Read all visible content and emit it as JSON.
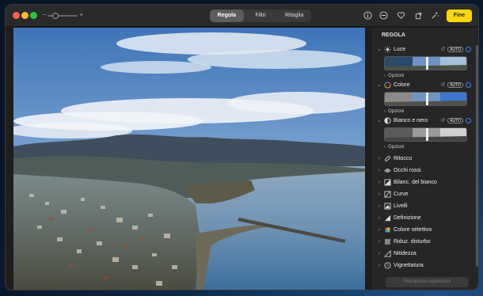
{
  "toolbar": {
    "tabs": [
      {
        "label": "Regola",
        "active": true
      },
      {
        "label": "Filtri",
        "active": false
      },
      {
        "label": "Ritaglia",
        "active": false
      }
    ],
    "done_label": "Fine",
    "icons": [
      "info-icon",
      "minus-circle-icon",
      "heart-icon",
      "rotate-icon",
      "magic-wand-icon"
    ]
  },
  "sidebar": {
    "title": "REGOLA",
    "expanded": [
      {
        "label": "Luce",
        "auto": "AUTO",
        "options": "Opzioni",
        "icon": "sun-icon"
      },
      {
        "label": "Colore",
        "auto": "AUTO",
        "options": "Opzioni",
        "icon": "color-circle-icon"
      },
      {
        "label": "Bianco e nero",
        "auto": "AUTO",
        "options": "Opzioni",
        "icon": "half-circle-icon"
      }
    ],
    "items": [
      {
        "label": "Ritocco",
        "icon": "bandage-icon"
      },
      {
        "label": "Occhi rossi",
        "icon": "eye-icon"
      },
      {
        "label": "Bilanc. del bianco",
        "icon": "white-balance-icon"
      },
      {
        "label": "Curve",
        "icon": "curves-icon"
      },
      {
        "label": "Livelli",
        "icon": "levels-icon"
      },
      {
        "label": "Definizione",
        "icon": "definition-icon"
      },
      {
        "label": "Colore selettivo",
        "icon": "selective-color-icon"
      },
      {
        "label": "Riduz. disturbo",
        "icon": "noise-icon"
      },
      {
        "label": "Nitidezza",
        "icon": "sharpen-icon"
      },
      {
        "label": "Vignettatura",
        "icon": "vignette-icon"
      }
    ],
    "reset_label": "Reimposta regolazioni"
  },
  "colors": {
    "accent": "#ffd60a",
    "selection": "#3a82f7"
  }
}
